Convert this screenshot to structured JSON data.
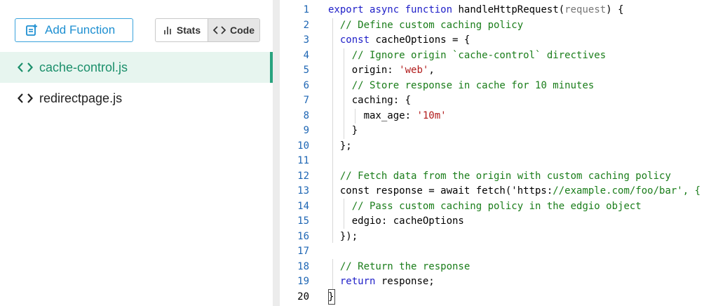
{
  "toolbar": {
    "add_function_label": "Add Function",
    "stats_label": "Stats",
    "code_label": "Code",
    "active_view": "Code"
  },
  "files": [
    {
      "name": "cache-control.js",
      "active": true
    },
    {
      "name": "redirectpage.js",
      "active": false
    }
  ],
  "editor": {
    "current_line": 20,
    "lines": [
      {
        "n": "1",
        "text": "export async function handleHttpRequest(request) {"
      },
      {
        "n": "2",
        "text": "  // Define custom caching policy"
      },
      {
        "n": "3",
        "text": "  const cacheOptions = {"
      },
      {
        "n": "4",
        "text": "    // Ignore origin `cache-control` directives"
      },
      {
        "n": "5",
        "text": "    origin: 'web',"
      },
      {
        "n": "6",
        "text": "    // Store response in cache for 10 minutes"
      },
      {
        "n": "7",
        "text": "    caching: {"
      },
      {
        "n": "8",
        "text": "      max_age: '10m'"
      },
      {
        "n": "9",
        "text": "    }"
      },
      {
        "n": "10",
        "text": "  };"
      },
      {
        "n": "11",
        "text": ""
      },
      {
        "n": "12",
        "text": "  // Fetch data from the origin with custom caching policy"
      },
      {
        "n": "13",
        "text": "  const response = await fetch('https://example.com/foo/bar', {"
      },
      {
        "n": "14",
        "text": "    // Pass custom caching policy in the edgio object"
      },
      {
        "n": "15",
        "text": "    edgio: cacheOptions"
      },
      {
        "n": "16",
        "text": "  });"
      },
      {
        "n": "17",
        "text": ""
      },
      {
        "n": "18",
        "text": "  // Return the response"
      },
      {
        "n": "19",
        "text": "  return response;"
      },
      {
        "n": "20",
        "text": "}"
      }
    ]
  },
  "colors": {
    "accent_green": "#2aa37f",
    "accent_blue": "#1d8fd1",
    "keyword": "#1e1ec8",
    "string": "#b11a1a",
    "comment": "#1a7d1a"
  },
  "icons": {
    "add_function": "add-document-icon",
    "stats": "bar-chart-icon",
    "code": "code-brackets-icon",
    "file": "code-brackets-icon"
  }
}
